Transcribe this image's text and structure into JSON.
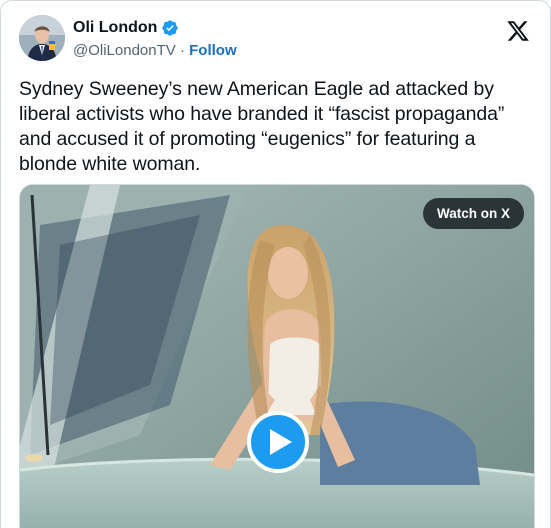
{
  "author": {
    "name": "Oli London",
    "handle": "@OliLondonTV",
    "separator": "·",
    "follow_label": "Follow",
    "verified": true
  },
  "brand_icon": "x-logo-icon",
  "tweet": {
    "text": "Sydney Sweeney’s new American Eagle ad attacked by liberal activists who have branded it “fascist propaganda” and accused it of promoting “eugenics” for featuring a blonde white woman."
  },
  "media": {
    "type": "video",
    "watch_label": "Watch on X",
    "play_icon": "play-icon"
  },
  "colors": {
    "verified_badge": "#1d9bf0",
    "follow_link": "#1d6fb8",
    "play_button": "#1d9bf0",
    "text": "#0f1419",
    "secondary_text": "#536471"
  }
}
